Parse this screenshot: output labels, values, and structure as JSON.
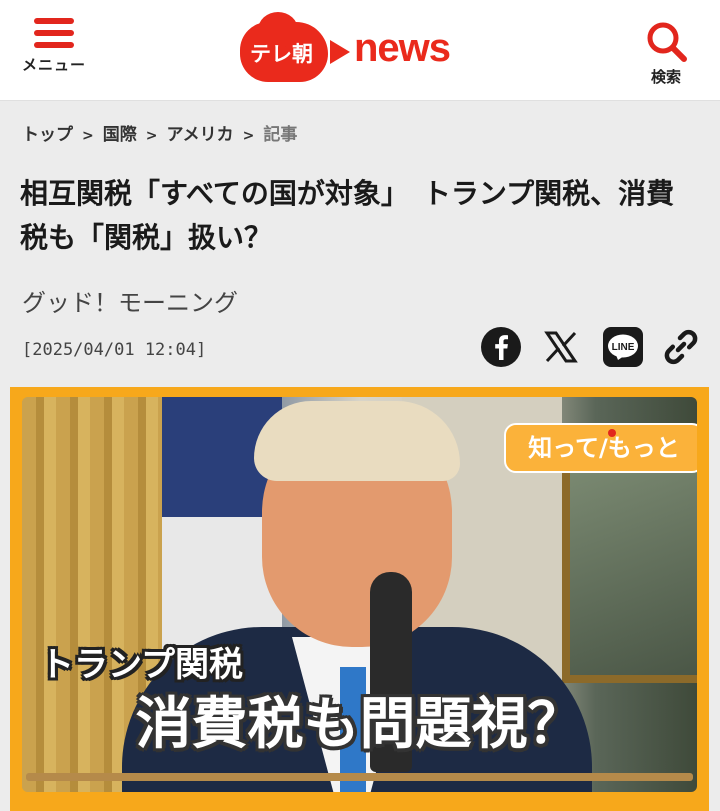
{
  "header": {
    "menu_label": "メニュー",
    "logo_text": "テレ朝",
    "logo_news": "news",
    "search_label": "検索",
    "brand_color": "#e2261d"
  },
  "breadcrumb": {
    "items": [
      "トップ",
      "国際",
      "アメリカ",
      "記事"
    ],
    "separator": ">"
  },
  "article": {
    "title": "相互関税「すべての国が対象」　トランプ関税、消費税も「関税」扱い？",
    "program": "グッド！モーニング",
    "date": "[2025/04/01 12:04]"
  },
  "share": {
    "icons": [
      "facebook-icon",
      "x-icon",
      "line-icon",
      "link-icon"
    ],
    "line_text": "LINE"
  },
  "hero": {
    "badge": "知って/もっと",
    "caption_small": "トランプ関税",
    "caption_large": "消費税も問題視？",
    "frame_color": "#f7a81b"
  }
}
